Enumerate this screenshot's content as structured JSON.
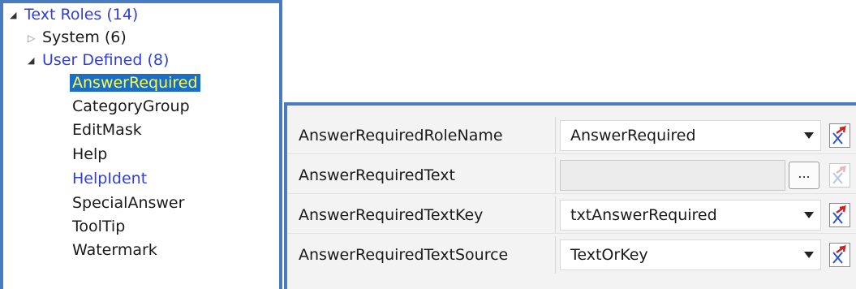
{
  "tree": {
    "root": {
      "label": "Text Roles (14)",
      "expanded": true
    },
    "system": {
      "label": "System (6)",
      "expanded": false
    },
    "user_defined": {
      "label": "User Defined (8)",
      "expanded": true
    },
    "items": [
      {
        "label": "AnswerRequired",
        "selected": true
      },
      {
        "label": "CategoryGroup"
      },
      {
        "label": "EditMask"
      },
      {
        "label": "Help"
      },
      {
        "label": "HelpIdent"
      },
      {
        "label": "SpecialAnswer"
      },
      {
        "label": "ToolTip"
      },
      {
        "label": "Watermark"
      }
    ]
  },
  "properties": [
    {
      "name": "AnswerRequiredRoleName",
      "value": "AnswerRequired",
      "editor": "dropdown",
      "reset_enabled": true
    },
    {
      "name": "AnswerRequiredText",
      "value": "",
      "editor": "ellipsis",
      "ellipsis_label": "...",
      "reset_enabled": false
    },
    {
      "name": "AnswerRequiredTextKey",
      "value": "txtAnswerRequired",
      "editor": "dropdown",
      "reset_enabled": true
    },
    {
      "name": "AnswerRequiredTextSource",
      "value": "TextOrKey",
      "editor": "dropdown",
      "reset_enabled": true
    }
  ],
  "colors": {
    "panel_border": "#4a7bbf",
    "selection_bg": "#1a6fc4",
    "selection_fg": "#fffb4a",
    "link_blue": "#2f3fd8",
    "reset_red": "#d42020",
    "reset_blue": "#2a55d4"
  }
}
